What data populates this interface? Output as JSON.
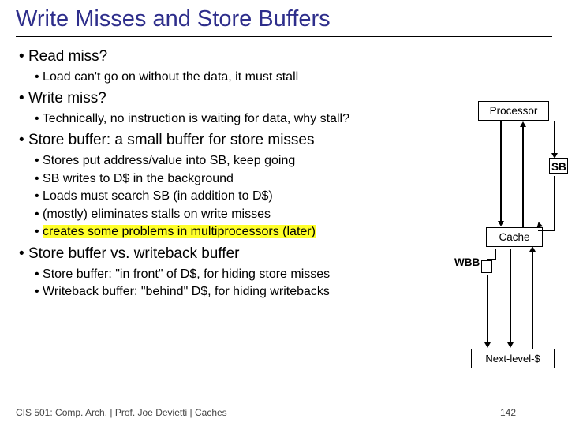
{
  "title": "Write Misses and Store Buffers",
  "b1": "Read miss?",
  "b1a": "Load can't go on without the data, it must stall",
  "b2": "Write miss?",
  "b2a": "Technically, no instruction is waiting for data, why stall?",
  "b3": "Store buffer: a small buffer for store misses",
  "b3a": "Stores put address/value into SB, keep going",
  "b3b": "SB writes to D$ in the background",
  "b3c": "Loads must search SB (in addition to D$)",
  "b3d": "(mostly) eliminates stalls on write misses",
  "b3e": "creates some problems in multiprocessors (later)",
  "b4": "Store buffer vs. writeback buffer",
  "b4a": "Store buffer: \"in front\" of D$, for hiding store misses",
  "b4b": "Writeback buffer: \"behind\" D$, for hiding writebacks",
  "footer": "CIS 501: Comp. Arch.  |  Prof. Joe Devietti  |  Caches",
  "page": "142",
  "diag": {
    "processor": "Processor",
    "cache": "Cache",
    "next": "Next-level-$",
    "sb": "SB",
    "wbb": "WBB"
  }
}
